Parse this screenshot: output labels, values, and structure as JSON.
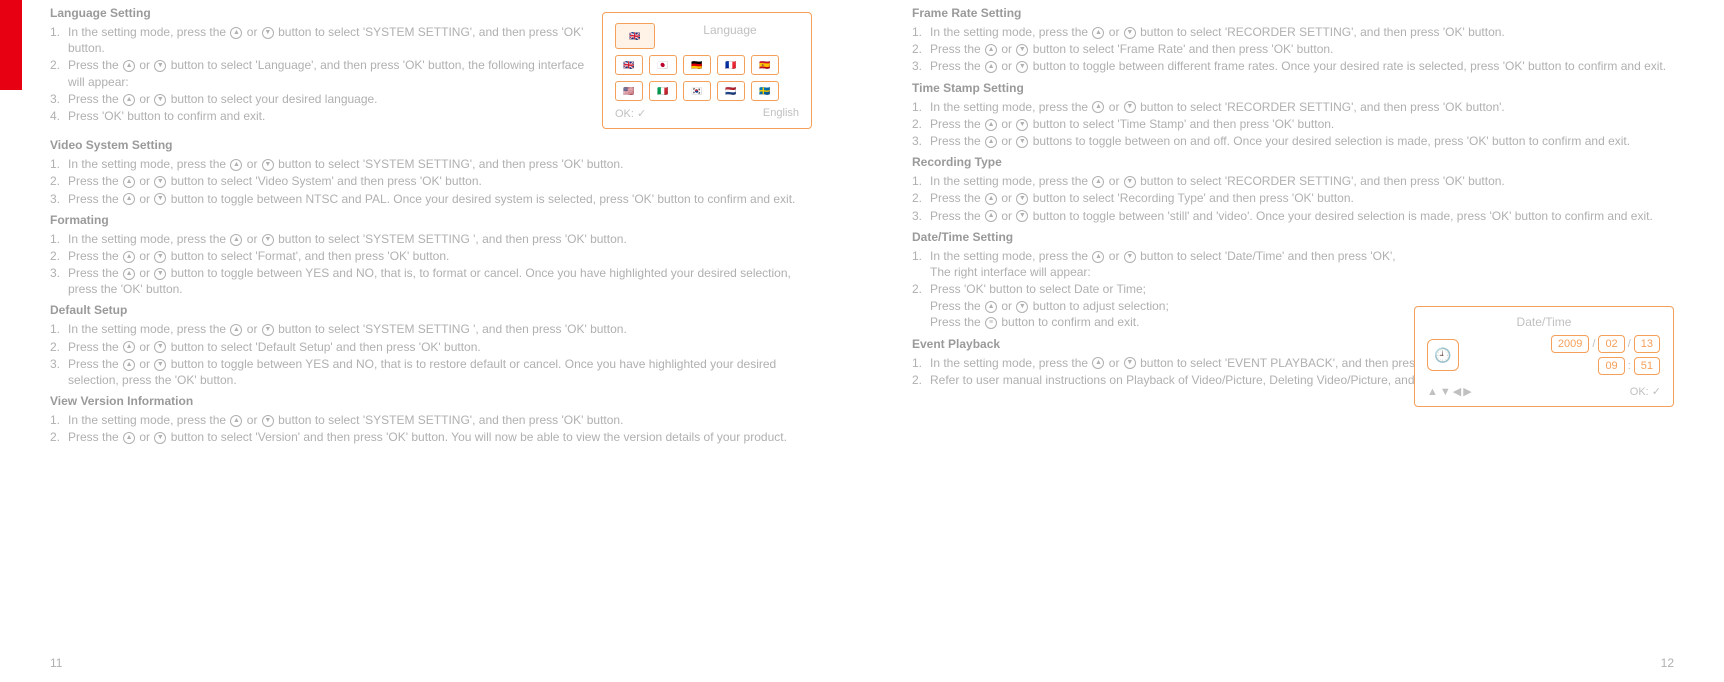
{
  "pages": {
    "left": "11",
    "right": "12"
  },
  "icons": {
    "up": "▲",
    "down": "▼",
    "ok": "OK:",
    "check": "✓",
    "menu": "≡",
    "arrows": "▲▼◀▶"
  },
  "langBox": {
    "title": "Language",
    "okLabel": "OK:",
    "okCheck": "✓",
    "selectedLabel": "English",
    "flags": {
      "top": "🇬🇧",
      "row1": [
        "🇬🇧",
        "🇯🇵",
        "🇩🇪",
        "🇫🇷",
        "🇪🇸"
      ],
      "row2": [
        "🇺🇸",
        "🇮🇹",
        "🇰🇷",
        "🇳🇱",
        "🇸🇪"
      ]
    }
  },
  "dtBox": {
    "title": "Date/Time",
    "clock": "🕘",
    "year": "2009",
    "month": "02",
    "day": "13",
    "hour": "09",
    "min": "51",
    "slash": "/",
    "colon": ":",
    "arrows": "▲▼◀▶",
    "okLabel": "OK:",
    "okCheck": "✓"
  },
  "left": {
    "s1": {
      "title": "Language Setting",
      "i1": "In the setting mode, press the [UD] button to select 'SYSTEM SETTING', and then press 'OK' button.",
      "i2": "Press the [UD] button to select 'Language', and then press 'OK' button, the following interface will appear:",
      "i3": "Press the [UD] button to select your desired language.",
      "i4": "Press 'OK' button to confirm and exit."
    },
    "s2": {
      "title": "Video System Setting",
      "i1": "In the setting mode, press the [UD] button to select 'SYSTEM SETTING', and then press 'OK' button.",
      "i2": "Press the [UD] button to select 'Video System' and then press 'OK' button.",
      "i3": "Press the [UD] button to toggle between NTSC and PAL. Once your desired system is selected, press 'OK' button to confirm and exit."
    },
    "s3": {
      "title": "Formating",
      "i1": "In the setting mode, press the [UD] button to select 'SYSTEM SETTING ', and then press 'OK' button.",
      "i2": "Press the [UD] button to select 'Format', and then press 'OK' button.",
      "i3": "Press the [UD] button to toggle between YES and NO, that is, to format or cancel. Once you have highlighted your desired selection, press the 'OK' button."
    },
    "s4": {
      "title": "Default Setup",
      "i1": "In the setting mode, press the [UD] button to select 'SYSTEM SETTING ', and then press 'OK' button.",
      "i2": "Press the [UD] button to select 'Default Setup' and then press 'OK' button.",
      "i3": "Press the [UD] button to toggle between YES and NO, that is to restore default or cancel. Once you have highlighted your desired selection, press the 'OK' button."
    },
    "s5": {
      "title": "View Version Information",
      "i1": "In the setting mode, press the [UD] button to select 'SYSTEM SETTING', and then press 'OK' button.",
      "i2": "Press the [UD] button to select 'Version' and then press 'OK' button. You will now be able to view the version details of your product."
    }
  },
  "right": {
    "s1": {
      "title": "Frame Rate Setting",
      "i1": "In the setting mode, press the [UD] button to select 'RECORDER SETTING', and then press 'OK' button.",
      "i2": "Press the [UD] button to select 'Frame Rate' and then press 'OK' button.",
      "i3": "Press the [UD] button to toggle between different frame rates. Once your desired rate is selected, press 'OK' button to confirm and exit."
    },
    "s2": {
      "title": "Time Stamp Setting",
      "i1": "In the setting mode, press the [UD] button to select 'RECORDER SETTING', and then press 'OK button'.",
      "i2": "Press the [UD] button to select 'Time Stamp' and then press 'OK' button.",
      "i3": "Press the [UD] buttons to toggle between on and off. Once your desired selection is made, press 'OK' button to confirm and exit."
    },
    "s3": {
      "title": "Recording Type",
      "i1": "In the setting mode, press the [UD] button to select 'RECORDER SETTING', and then press 'OK' button.",
      "i2": "Press the [UD] button to select 'Recording Type' and then press 'OK' button.",
      "i3": "Press the [UD] button to toggle between 'still' and 'video'. Once your desired selection is made, press 'OK' button to confirm and exit."
    },
    "s4": {
      "title": "Date/Time Setting",
      "i1": "In the setting mode, press the [UD] button to select 'Date/Time' and then press 'OK', The right interface will appear:",
      "i2a": "Press 'OK' button to select Date or Time;",
      "i2b": "Press the [UD] button to adjust selection;",
      "i2c": "Press the [MENU] button to confirm and exit."
    },
    "s5": {
      "title": "Event Playback",
      "i1": "In the setting mode, press the [UD] button to select 'EVENT PLAYBACK', and then press 'OK' button.",
      "i2": "Refer to user manual instructions on Playback of Video/Picture, Deleting Video/Picture, and Deleting Folder for guidance."
    }
  },
  "nums": {
    "n1": "1.",
    "n2": "2.",
    "n3": "3.",
    "n4": "4."
  }
}
